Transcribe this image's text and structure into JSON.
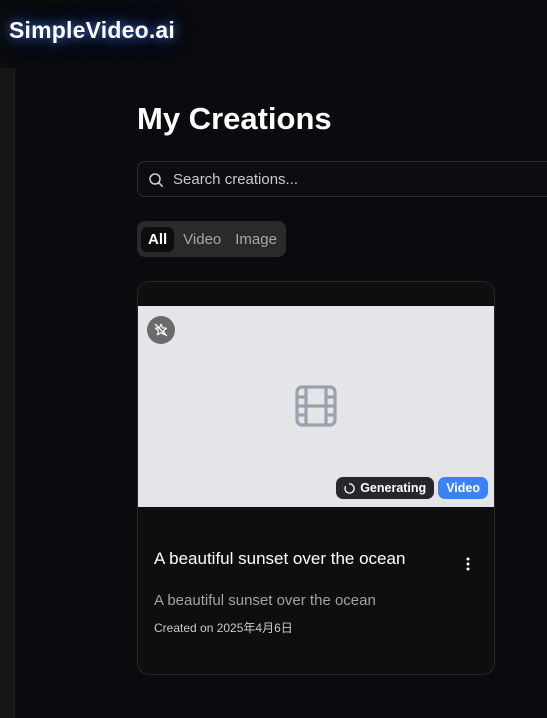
{
  "app": {
    "logo_text": "SimpleVideo.ai"
  },
  "page": {
    "title": "My Creations"
  },
  "search": {
    "placeholder": "Search creations...",
    "value": ""
  },
  "filters": {
    "tabs": [
      {
        "label": "All",
        "active": true
      },
      {
        "label": "Video",
        "active": false
      },
      {
        "label": "Image",
        "active": false
      }
    ]
  },
  "creations": [
    {
      "title": "A beautiful sunset over the ocean",
      "description": "A beautiful sunset over the ocean",
      "created": "Created on 2025年4月6日",
      "status": "Generating",
      "type": "Video",
      "thumbnail_icon": "film-icon",
      "overlay_icon": "muted-star-icon"
    }
  ],
  "colors": {
    "background": "#0a0b0e",
    "accent": "#3b82f6",
    "card": "#0e0e0e",
    "thumbnail_placeholder": "#e4e5e9"
  }
}
